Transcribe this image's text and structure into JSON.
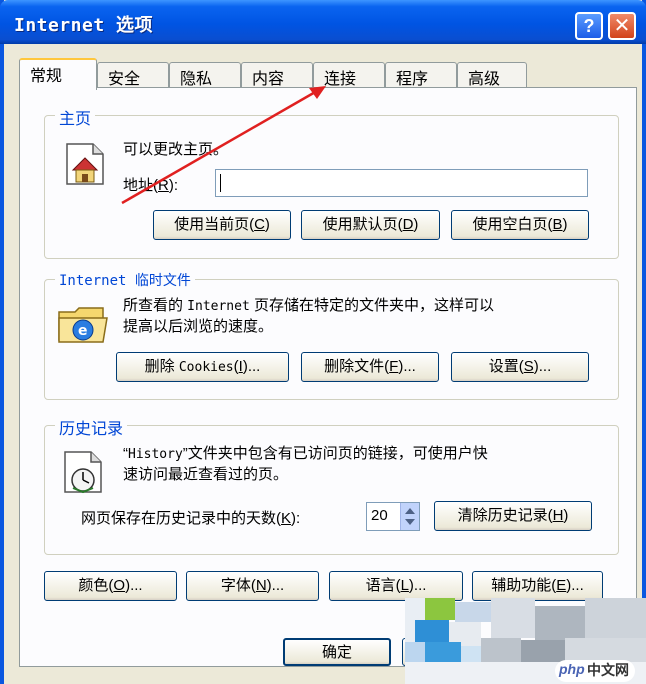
{
  "window": {
    "title": "Internet 选项",
    "help_glyph": "?",
    "close_glyph": "✕"
  },
  "tabs": [
    "常规",
    "安全",
    "隐私",
    "内容",
    "连接",
    "程序",
    "高级"
  ],
  "home": {
    "legend": "主页",
    "desc": "可以更改主页。",
    "address_label": "地址",
    "address_key": "R",
    "address_value": "",
    "buttons": [
      {
        "label": "使用当前页",
        "key": "C"
      },
      {
        "label": "使用默认页",
        "key": "D"
      },
      {
        "label": "使用空白页",
        "key": "B"
      }
    ]
  },
  "temp_files": {
    "legend": "Internet 临时文件",
    "desc_pre": "所查看的 ",
    "desc_mono": "Internet",
    "desc_post": " 页存储在特定的文件夹中，这样可以",
    "desc_line2": "提高以后浏览的速度。",
    "buttons": [
      {
        "label": "删除 ",
        "mono": "Cookies",
        "key": "I",
        "suffix": "..."
      },
      {
        "label": "删除文件",
        "key": "F",
        "suffix": "..."
      },
      {
        "label": "设置",
        "key": "S",
        "suffix": "..."
      }
    ]
  },
  "history": {
    "legend": "历史记录",
    "desc_pre": "“",
    "desc_mono": "History",
    "desc_post": "”文件夹中包含有已访问页的链接，可使用户快",
    "desc_line2": "速访问最近查看过的页。",
    "days_label": "网页保存在历史记录中的天数",
    "days_key": "K",
    "days_value": "20",
    "clear_button": {
      "label": "清除历史记录",
      "key": "H"
    }
  },
  "bottom_buttons": [
    {
      "label": "颜色",
      "key": "O",
      "suffix": "..."
    },
    {
      "label": "字体",
      "key": "N",
      "suffix": "..."
    },
    {
      "label": "语言",
      "key": "L",
      "suffix": "..."
    },
    {
      "label": "辅助功能",
      "key": "E",
      "suffix": "..."
    }
  ],
  "dialog_buttons": {
    "ok": "确定"
  },
  "watermark": "中文网",
  "watermark_brand": "php",
  "colors": {
    "title_blue": "#0054e3",
    "legend_blue": "#0046d5",
    "arrow_red": "#e02020",
    "tab_highlight": "#ffc73c"
  }
}
